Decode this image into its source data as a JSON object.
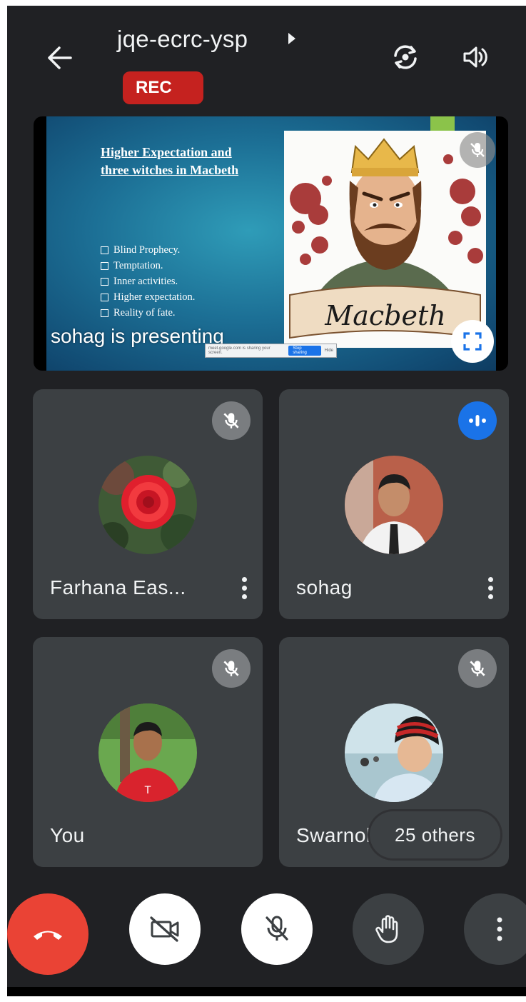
{
  "header": {
    "meeting_code": "jqe-ecrc-ysp",
    "rec_label": "REC",
    "icons": [
      "back-arrow-icon",
      "caret-right-icon",
      "switch-camera-icon",
      "speaker-icon"
    ]
  },
  "presentation": {
    "slide_heading": "Higher Expectation and three witches in Macbeth",
    "slide_bullets": [
      "Blind Prophecy.",
      "Temptation.",
      "Inner activities.",
      "Higher expectation.",
      "Reality of fate."
    ],
    "image_caption": "Macbeth",
    "presenting_label": "sohag is presenting",
    "stop_bar": {
      "message": "meet.google.com is sharing your screen.",
      "stop_label": "Stop sharing",
      "hide_label": "Hide"
    },
    "icons": [
      "mic-off-icon",
      "fullscreen-icon"
    ]
  },
  "participants": [
    {
      "name": "Farhana Eas...",
      "status": "muted",
      "icon": "mic-off-icon"
    },
    {
      "name": "sohag",
      "status": "speaking",
      "icon": "audio-level-icon"
    },
    {
      "name": "You",
      "status": "muted",
      "icon": "mic-off-icon"
    },
    {
      "name": "Swarnol",
      "status": "muted",
      "icon": "mic-off-icon"
    }
  ],
  "others_label": "25 others",
  "controls": [
    {
      "name": "end-call",
      "icon": "hang-up-icon",
      "color": "#ea4335"
    },
    {
      "name": "camera",
      "icon": "camera-off-icon",
      "state": "off"
    },
    {
      "name": "microphone",
      "icon": "mic-off-icon",
      "state": "off"
    },
    {
      "name": "raise-hand",
      "icon": "hand-icon"
    },
    {
      "name": "more-options",
      "icon": "more-vert-icon"
    }
  ],
  "colors": {
    "background": "#202124",
    "tile": "#3c4043",
    "rec": "#c5221f",
    "speaking": "#1a73e8",
    "hangup": "#ea4335"
  }
}
